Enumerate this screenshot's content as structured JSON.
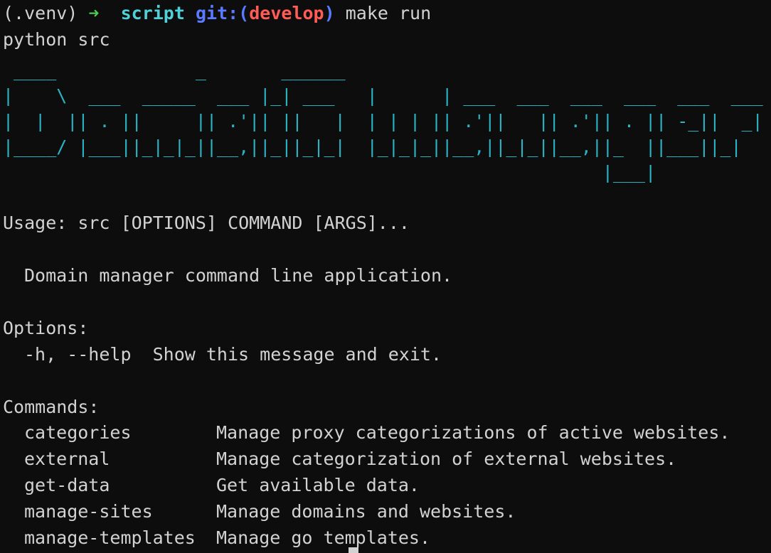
{
  "prompt": {
    "venv": "(.venv)",
    "arrow": "➜",
    "directory": "script",
    "git_label": "git:(",
    "branch": "develop",
    "git_close": ")",
    "command": "make run"
  },
  "exec_line": "python src",
  "banner_ascii": " ____             _       ______\n|    \\  ___  _____  ___ |_| ___   |      | ___  ___  ___  ___  ___  ___\n|  |  || . ||     || .'|| ||   |  | | | || .'||   || .'|| . || -_||  _|\n|____/ |___||_|_|_||__,||_||_|_|  |_|_|_||__,||_|_||__,||_  ||___||_|\n                                                        |___|",
  "usage": "Usage: src [OPTIONS] COMMAND [ARGS]...",
  "description": "Domain manager command line application.",
  "options_header": "Options:",
  "options": [
    {
      "flag": "-h, --help",
      "desc": "Show this message and exit."
    }
  ],
  "commands_header": "Commands:",
  "commands": [
    {
      "name": "categories",
      "desc": "Manage proxy categorizations of active websites."
    },
    {
      "name": "external",
      "desc": "Manage categorization of external websites."
    },
    {
      "name": "get-data",
      "desc": "Get available data."
    },
    {
      "name": "manage-sites",
      "desc": "Manage domains and websites."
    },
    {
      "name": "manage-templates",
      "desc": "Manage go templates."
    }
  ],
  "colors": {
    "background": "#0d0d0d",
    "text": "#d2d2d2",
    "prompt_arrow": "#4ec94e",
    "prompt_dir": "#4fd1d9",
    "prompt_git": "#5b7bff",
    "prompt_branch": "#ff5c57",
    "banner": "#2bb5c4"
  }
}
